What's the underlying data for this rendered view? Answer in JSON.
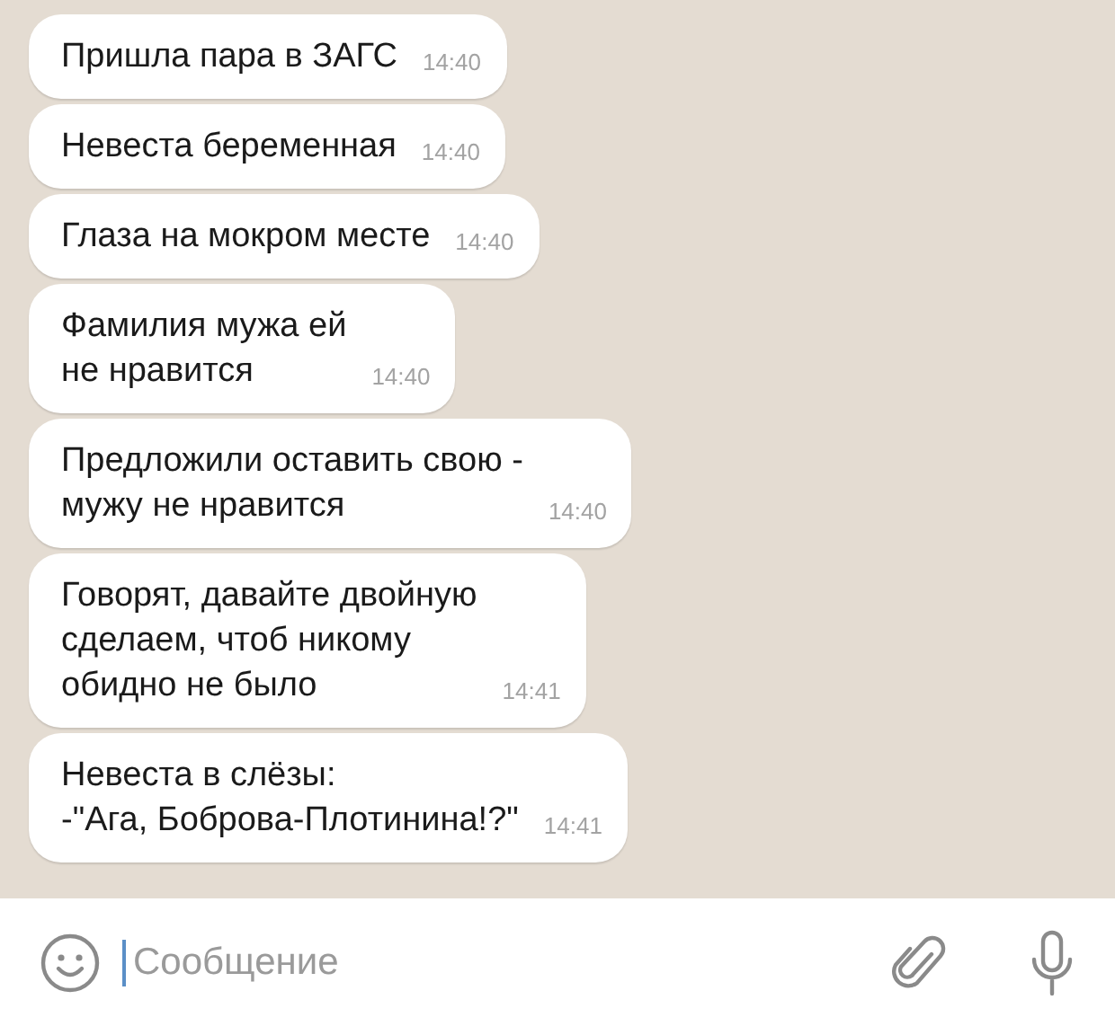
{
  "messages": [
    {
      "text": "Пришла пара в ЗАГС",
      "time": "14:40"
    },
    {
      "text": "Невеста беременная",
      "time": "14:40"
    },
    {
      "text": "Глаза на мокром месте",
      "time": "14:40"
    },
    {
      "text": "Фамилия мужа ей\nне нравится",
      "time": "14:40"
    },
    {
      "text": "Предложили оставить свою -\nмужу не нравится",
      "time": "14:40"
    },
    {
      "text": "Говорят, давайте двойную\nсделаем, чтоб никому\nобидно не было",
      "time": "14:41"
    },
    {
      "text": "Невеста в слёзы:\n-\"Ага, Боброва-Плотинина!?\"",
      "time": "14:41"
    }
  ],
  "composer": {
    "placeholder": "Сообщение"
  }
}
